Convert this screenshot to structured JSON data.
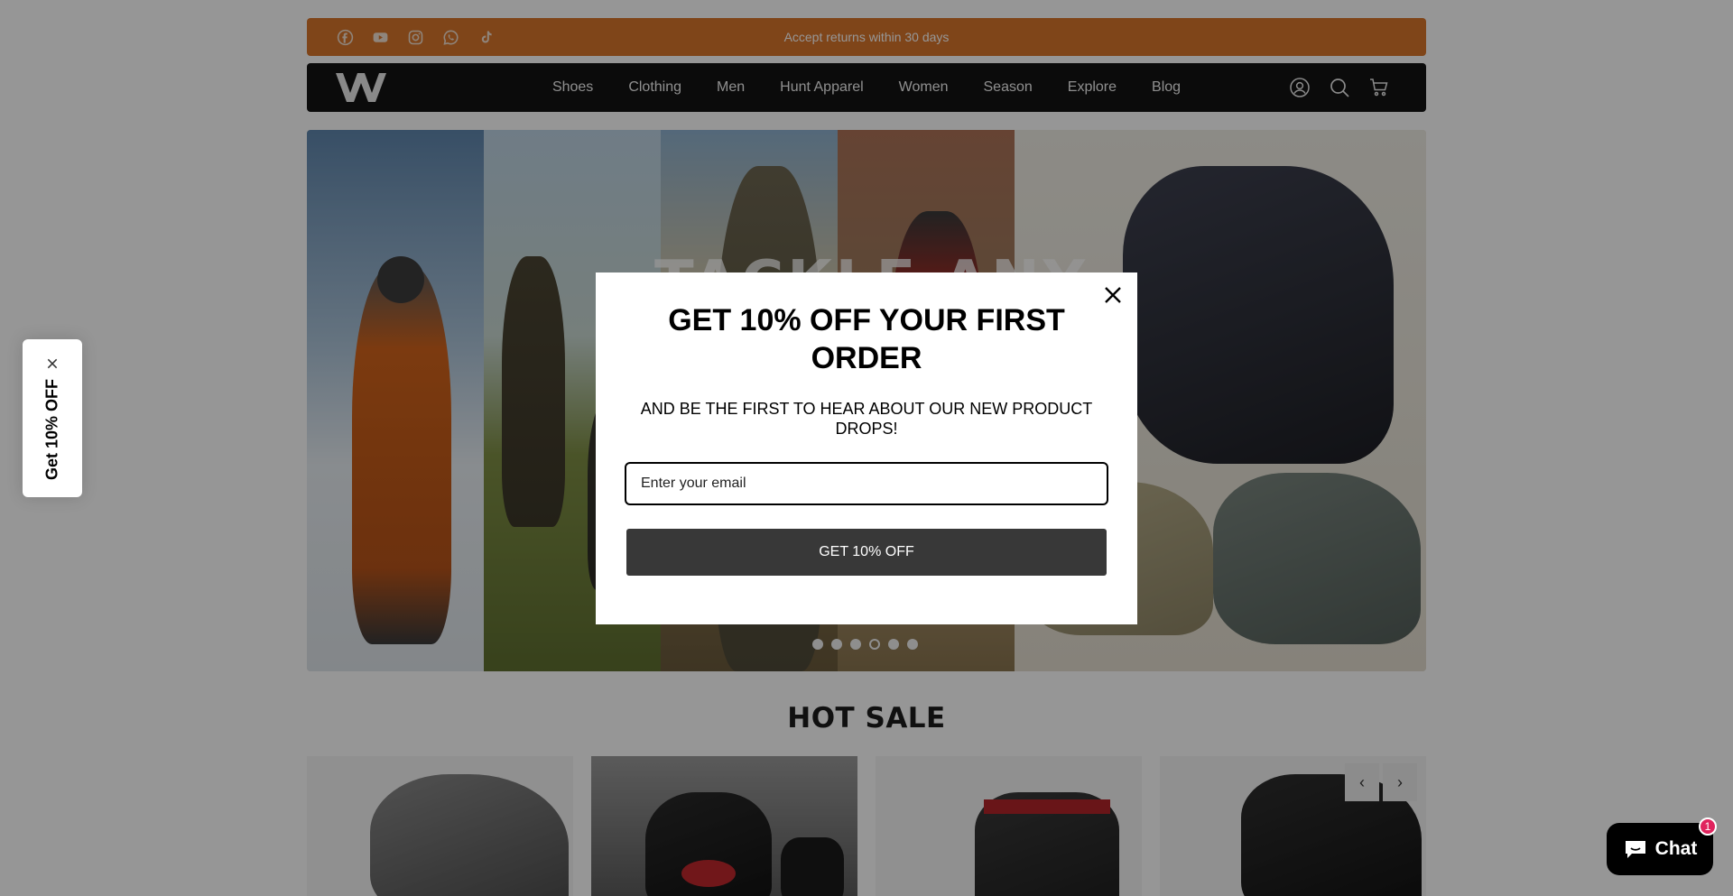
{
  "announcement": {
    "text": "Accept returns within 30 days",
    "background": "#d9752b"
  },
  "social_icons": [
    "facebook-icon",
    "youtube-icon",
    "instagram-icon",
    "whatsapp-icon",
    "tiktok-icon"
  ],
  "header": {
    "nav": [
      "Shoes",
      "Clothing",
      "Men",
      "Hunt Apparel",
      "Women",
      "Season",
      "Explore",
      "Blog"
    ],
    "icons": [
      "account-icon",
      "search-icon",
      "cart-icon"
    ]
  },
  "hero": {
    "headline_partial": "TACKLE ANY",
    "slide_count": 6,
    "active_slide": 4
  },
  "hot_sale": {
    "title": "HOT SALE",
    "prev": "‹",
    "next": "›"
  },
  "popup": {
    "title": "GET 10% OFF YOUR FIRST ORDER",
    "subtitle": "AND BE THE FIRST TO HEAR ABOUT OUR NEW PRODUCT DROPS!",
    "email_placeholder": "Enter your email",
    "button_label": "GET 10% OFF",
    "close": "×"
  },
  "teaser": {
    "label": "Get 10% OFF",
    "close": "×"
  },
  "chat": {
    "label": "Chat",
    "badge": "1"
  }
}
